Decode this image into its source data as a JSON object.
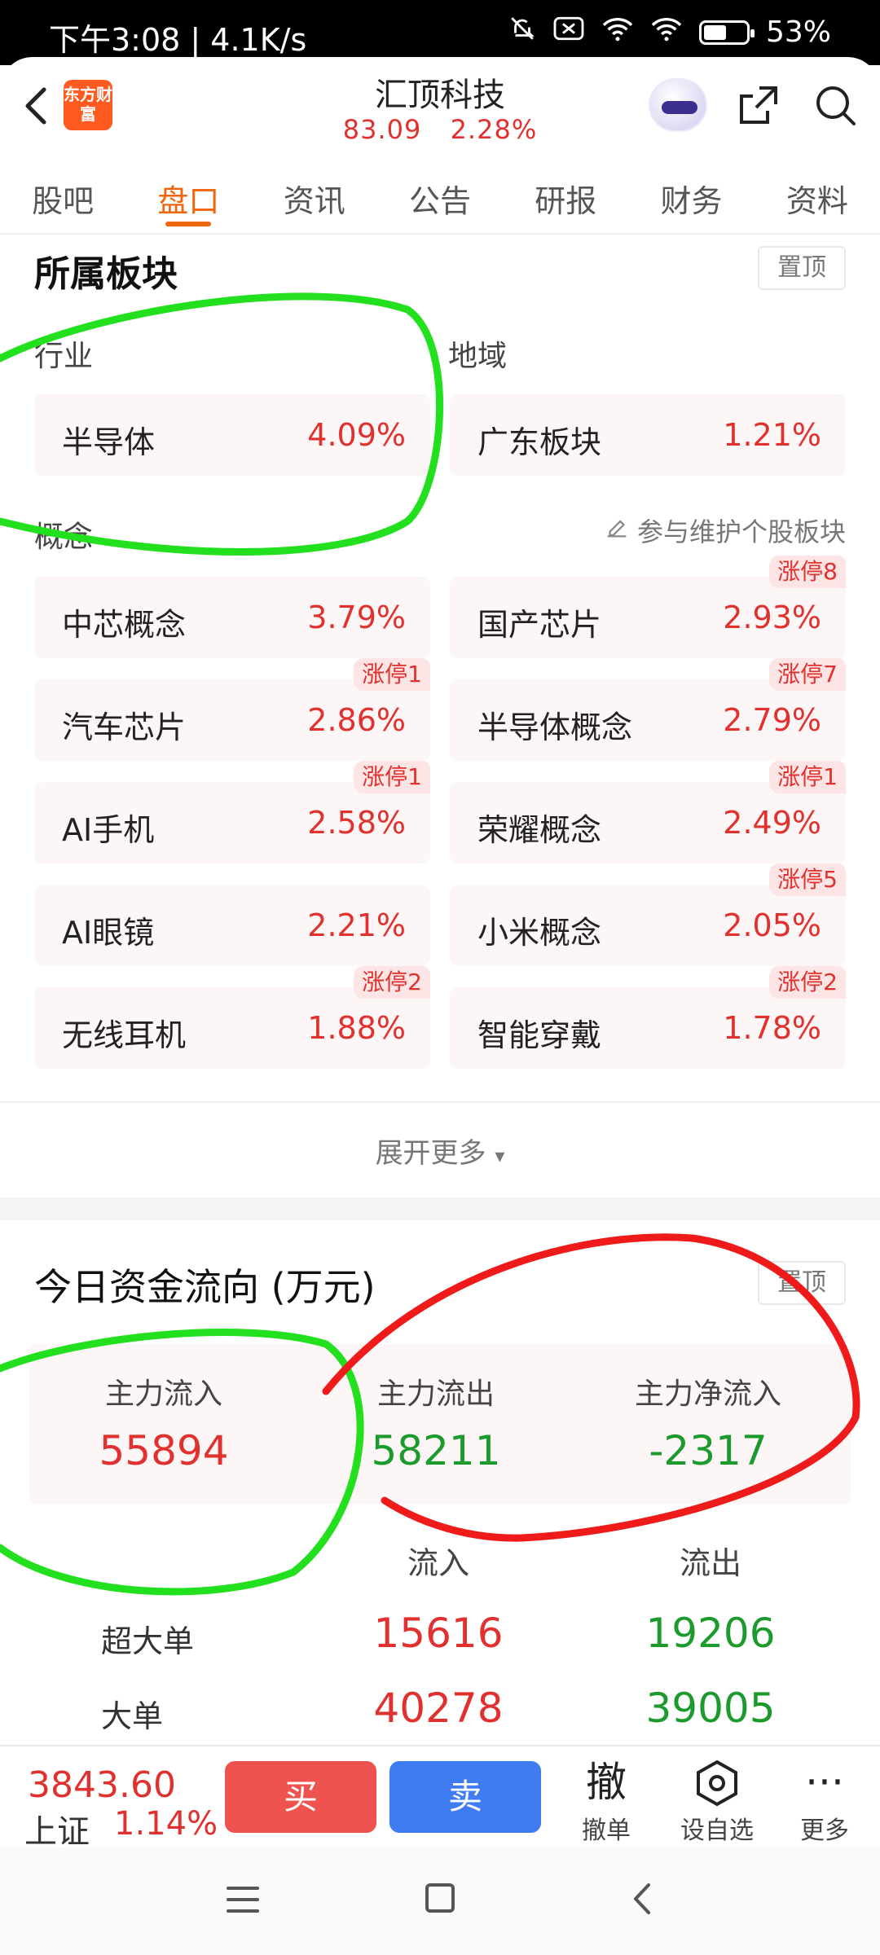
{
  "status_bar": {
    "time": "下午3:08 | 4.1K/s",
    "battery": "53%",
    "battery_level": 0.53
  },
  "header": {
    "logo_text": "东方财富",
    "title": "汇顶科技",
    "price": "83.09",
    "change_pct": "2.28%"
  },
  "tabs": [
    "股吧",
    "盘口",
    "资讯",
    "公告",
    "研报",
    "财务",
    "资料"
  ],
  "active_tab": 1,
  "sectors": {
    "title": "所属板块",
    "pin_label": "置顶",
    "industry_label": "行业",
    "region_label": "地域",
    "industry": {
      "name": "半导体",
      "pct": "4.09%"
    },
    "region": {
      "name": "广东板块",
      "pct": "1.21%"
    },
    "concept_label": "概念",
    "maintain_label": "参与维护个股板块",
    "concepts": [
      {
        "name": "中芯概念",
        "pct": "3.79%",
        "badge": ""
      },
      {
        "name": "国产芯片",
        "pct": "2.93%",
        "badge": "涨停8"
      },
      {
        "name": "汽车芯片",
        "pct": "2.86%",
        "badge": "涨停1"
      },
      {
        "name": "半导体概念",
        "pct": "2.79%",
        "badge": "涨停7"
      },
      {
        "name": "AI手机",
        "pct": "2.58%",
        "badge": "涨停1"
      },
      {
        "name": "荣耀概念",
        "pct": "2.49%",
        "badge": "涨停1"
      },
      {
        "name": "AI眼镜",
        "pct": "2.21%",
        "badge": ""
      },
      {
        "name": "小米概念",
        "pct": "2.05%",
        "badge": "涨停5"
      },
      {
        "name": "无线耳机",
        "pct": "1.88%",
        "badge": "涨停2"
      },
      {
        "name": "智能穿戴",
        "pct": "1.78%",
        "badge": "涨停2"
      }
    ],
    "expand_label": "展开更多"
  },
  "fund_flow": {
    "title": "今日资金流向 (万元)",
    "pin_label": "置顶",
    "main_in_label": "主力流入",
    "main_in": "55894",
    "main_out_label": "主力流出",
    "main_out": "58211",
    "main_net_label": "主力净流入",
    "main_net": "-2317",
    "col_in": "流入",
    "col_out": "流出",
    "rows": [
      {
        "label": "超大单",
        "in": "15616",
        "out": "19206"
      },
      {
        "label": "大单",
        "in": "40278",
        "out": "39005"
      }
    ]
  },
  "bottom_bar": {
    "index_value": "3843.60",
    "index_name": "上证",
    "index_pct": "1.14%",
    "buy": "买",
    "sell": "卖",
    "cancel_icon": "撤",
    "cancel_label": "撤单",
    "watch_label": "设自选",
    "more_label": "更多"
  },
  "colors": {
    "accent": "#f0650e",
    "up": "#e0312f",
    "down": "#1c9a2e",
    "buy": "#ef5350",
    "sell": "#3f7cf0"
  }
}
